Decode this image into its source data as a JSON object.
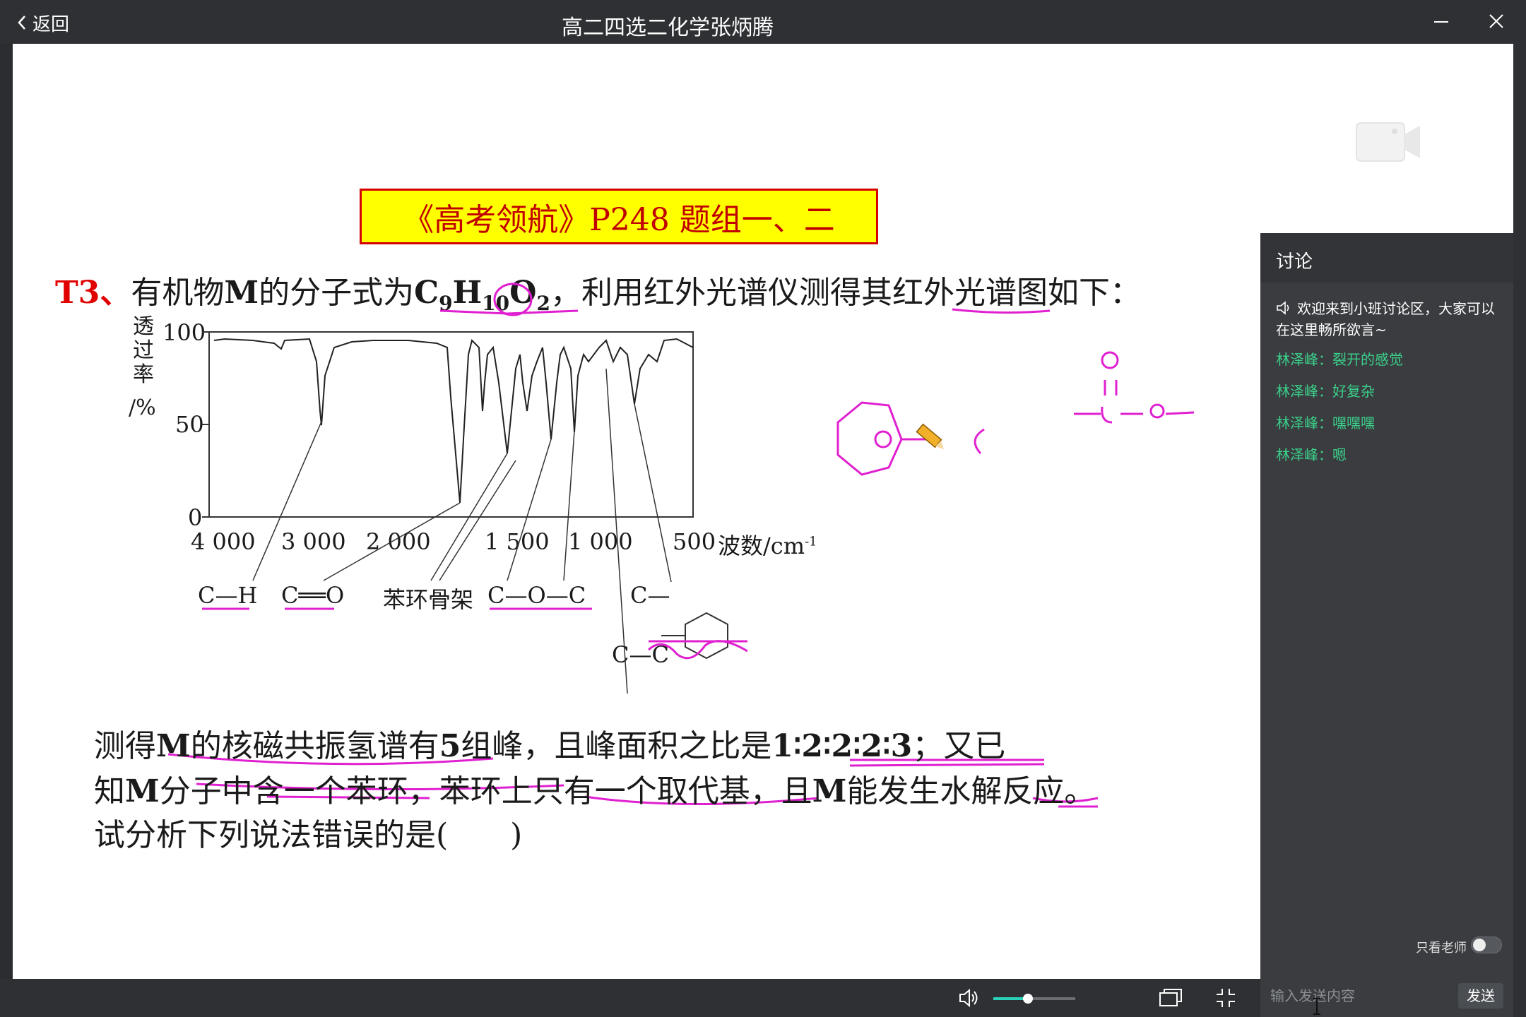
{
  "window": {
    "back_label": "返回",
    "title": "高二四选二化学张炳腾"
  },
  "slide": {
    "banner": "《高考领航》P248 题组一、二",
    "question": {
      "num": "T3、",
      "t1": "有机物",
      "m": "M",
      "t2": "的分子式为",
      "f_c": "C",
      "f_c_sub": "9",
      "f_h": "H",
      "f_h_sub": "10",
      "f_o": "O",
      "f_o_sub": "2",
      "t3": "，利用红外光谱仪测得其红外光谱图如下："
    },
    "spectrum": {
      "ylabel_chars": [
        "透",
        "过",
        "率"
      ],
      "ylabel_unit": "/%",
      "yticks": [
        "100",
        "50",
        "0"
      ],
      "xticks": [
        "4 000",
        "3 000",
        "2 000",
        "1 500",
        "1 000",
        "500"
      ],
      "xlabel": "波数/cm",
      "xlabel_sup": "-1",
      "bonds": [
        "C—H",
        "C══O",
        "苯环骨架",
        "C—O—C",
        "C—",
        "C—C"
      ]
    },
    "para1_a": "测得",
    "para1_m": "M",
    "para1_b": "的核磁共振氢谱有",
    "para1_n": "5",
    "para1_c": "组峰，且峰面积之比是",
    "para1_ratio": "1∶2∶2∶2∶3",
    "para1_d": "；又已",
    "para2_a": "知",
    "para2_m": "M",
    "para2_b": "分子中含一个苯环，苯环上只有一个取代基，且",
    "para2_m2": "M",
    "para2_c": "能发生水解反应。",
    "para3": "试分析下列说法错误的是(　　)"
  },
  "chat": {
    "header": "讨论",
    "messages": [
      {
        "text": "欢迎来到小班讨论区，大家可以在这里畅所欲言~",
        "type": "system"
      },
      {
        "text": "林泽峰：裂开的感觉",
        "type": "user"
      },
      {
        "text": "林泽峰：好复杂",
        "type": "user"
      },
      {
        "text": "林泽峰：嘿嘿嘿",
        "type": "user"
      },
      {
        "text": "林泽峰：嗯",
        "type": "user"
      }
    ],
    "teacher_only_label": "只看老师",
    "teacher_only": false,
    "input_placeholder": "输入发送内容",
    "send_label": "发送"
  },
  "player": {
    "volume": 0.42
  },
  "colors": {
    "annotation": "#e020d0",
    "chat_user": "#3bd18a",
    "accent": "#2ad1b8"
  }
}
